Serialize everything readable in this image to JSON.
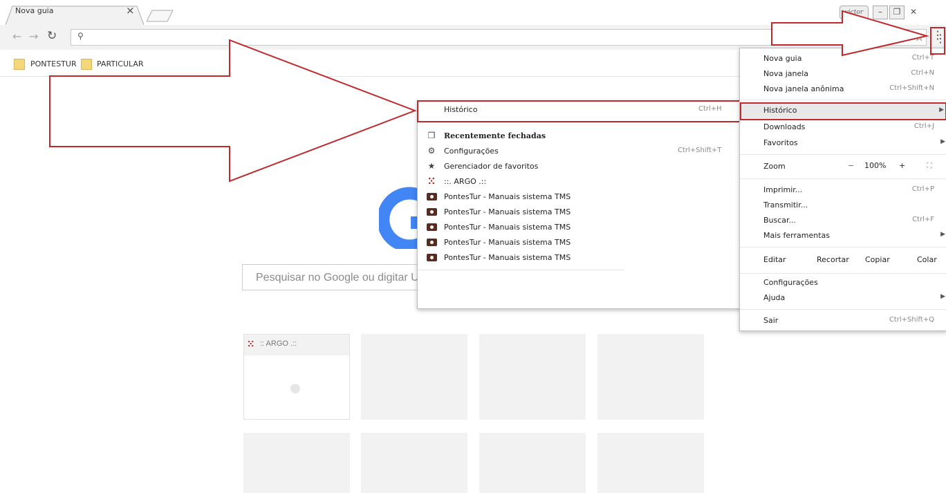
{
  "tab": {
    "title": "Nova guia"
  },
  "window": {
    "user": "victor"
  },
  "bookmarks": [
    {
      "label": "PONTESTUR"
    },
    {
      "label": "PARTICULAR"
    }
  ],
  "page": {
    "search_placeholder": "Pesquisar no Google ou digitar URL",
    "tile_argo_title": ":: ARGO .::"
  },
  "menu": {
    "items": [
      {
        "label": "Nova guia",
        "shortcut": "Ctrl+T"
      },
      {
        "label": "Nova janela",
        "shortcut": "Ctrl+N"
      },
      {
        "label": "Nova janela anônima",
        "shortcut": "Ctrl+Shift+N"
      },
      {
        "label": "Histórico",
        "shortcut": ""
      },
      {
        "label": "Downloads",
        "shortcut": "Ctrl+J"
      },
      {
        "label": "Favoritos",
        "shortcut": ""
      },
      {
        "label": "Zoom",
        "shortcut": ""
      },
      {
        "label": "Imprimir...",
        "shortcut": "Ctrl+P"
      },
      {
        "label": "Transmitir...",
        "shortcut": ""
      },
      {
        "label": "Buscar...",
        "shortcut": "Ctrl+F"
      },
      {
        "label": "Mais ferramentas",
        "shortcut": ""
      },
      {
        "label": "Editar",
        "shortcut": ""
      },
      {
        "label": "Configurações",
        "shortcut": ""
      },
      {
        "label": "Ajuda",
        "shortcut": ""
      },
      {
        "label": "Sair",
        "shortcut": "Ctrl+Shift+Q"
      }
    ],
    "zoom": {
      "minus": "−",
      "value": "100%",
      "plus": "+"
    },
    "edit": {
      "cut": "Recortar",
      "copy": "Copiar",
      "paste": "Colar"
    }
  },
  "history": {
    "title": "Histórico",
    "title_shortcut": "Ctrl+H",
    "items": [
      {
        "label": "Recentemente fechadas",
        "shortcut": "",
        "icon": "window-icon"
      },
      {
        "label": "Configurações",
        "shortcut": "Ctrl+Shift+T",
        "icon": "gear-icon"
      },
      {
        "label": "Gerenciador de favoritos",
        "shortcut": "",
        "icon": "star-icon"
      },
      {
        "label": "::. ARGO .::",
        "shortcut": "",
        "icon": "argo-icon"
      },
      {
        "label": "PontesTur - Manuais sistema TMS",
        "shortcut": "",
        "icon": "camera-icon"
      },
      {
        "label": "PontesTur - Manuais sistema TMS",
        "shortcut": "",
        "icon": "camera-icon"
      },
      {
        "label": "PontesTur - Manuais sistema TMS",
        "shortcut": "",
        "icon": "camera-icon"
      },
      {
        "label": "PontesTur - Manuais sistema TMS",
        "shortcut": "",
        "icon": "camera-icon"
      },
      {
        "label": "PontesTur - Manuais sistema TMS",
        "shortcut": "",
        "icon": "camera-icon"
      }
    ]
  },
  "colors": {
    "highlight_red": "#c0282c",
    "google_blue": "#4285f4"
  }
}
